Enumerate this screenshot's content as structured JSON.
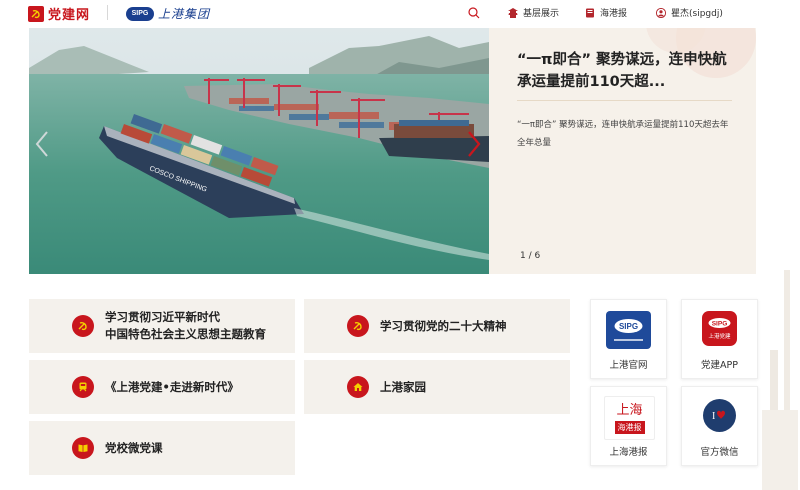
{
  "header": {
    "party_site_name": "党建网",
    "party_icon": "party-emblem-icon",
    "sipg_badge": "SIPG",
    "sipg_cn_name": "上港集团",
    "search_icon": "search-icon",
    "links": [
      {
        "label": "基层展示",
        "icon": "pagoda-icon"
      },
      {
        "label": "海港报",
        "icon": "newspaper-icon"
      },
      {
        "label": "瞿杰(sipgdj)",
        "icon": "user-icon"
      }
    ]
  },
  "hero": {
    "image_description_icon": "port-photo",
    "ship_text": "COSCO SHIPPING"
  },
  "news": {
    "title": "“一π即合” 聚势谋远，连申快航承运量提前110天超...",
    "summary": "“一π即合” 聚势谋远，连申快航承运量提前110天超去年全年总量",
    "pager": "1 / 6"
  },
  "topics": [
    {
      "line1": "学习贯彻习近平新时代",
      "line2": "中国特色社会主义思想主题教育",
      "icon": "party-emblem-icon"
    },
    {
      "line1": "学习贯彻党的二十大精神",
      "line2": "",
      "icon": "party-emblem-icon"
    },
    {
      "line1": "《上港党建•走进新时代》",
      "line2": "",
      "icon": "train-icon"
    },
    {
      "line1": "上港家园",
      "line2": "",
      "icon": "home-icon"
    },
    {
      "line1": "党校微党课",
      "line2": "",
      "icon": "book-icon"
    }
  ],
  "apps": [
    {
      "label": "上港官网",
      "badge": "SIPG",
      "icon": "sipg-logo-icon"
    },
    {
      "label": "党建APP",
      "badge": "SIPG",
      "sub": "上港党建",
      "icon": "party-app-icon"
    },
    {
      "label": "上海港报",
      "logo_line1": "上海",
      "logo_line2": "海港报",
      "icon": "harbor-newspaper-icon"
    },
    {
      "label": "官方微信",
      "icon": "wechat-logo-icon"
    }
  ],
  "colors": {
    "party_red": "#c8161d",
    "sipg_blue": "#1a3f8f",
    "card_bg": "#f4f1ec",
    "news_bg": "#f6f1ea"
  }
}
